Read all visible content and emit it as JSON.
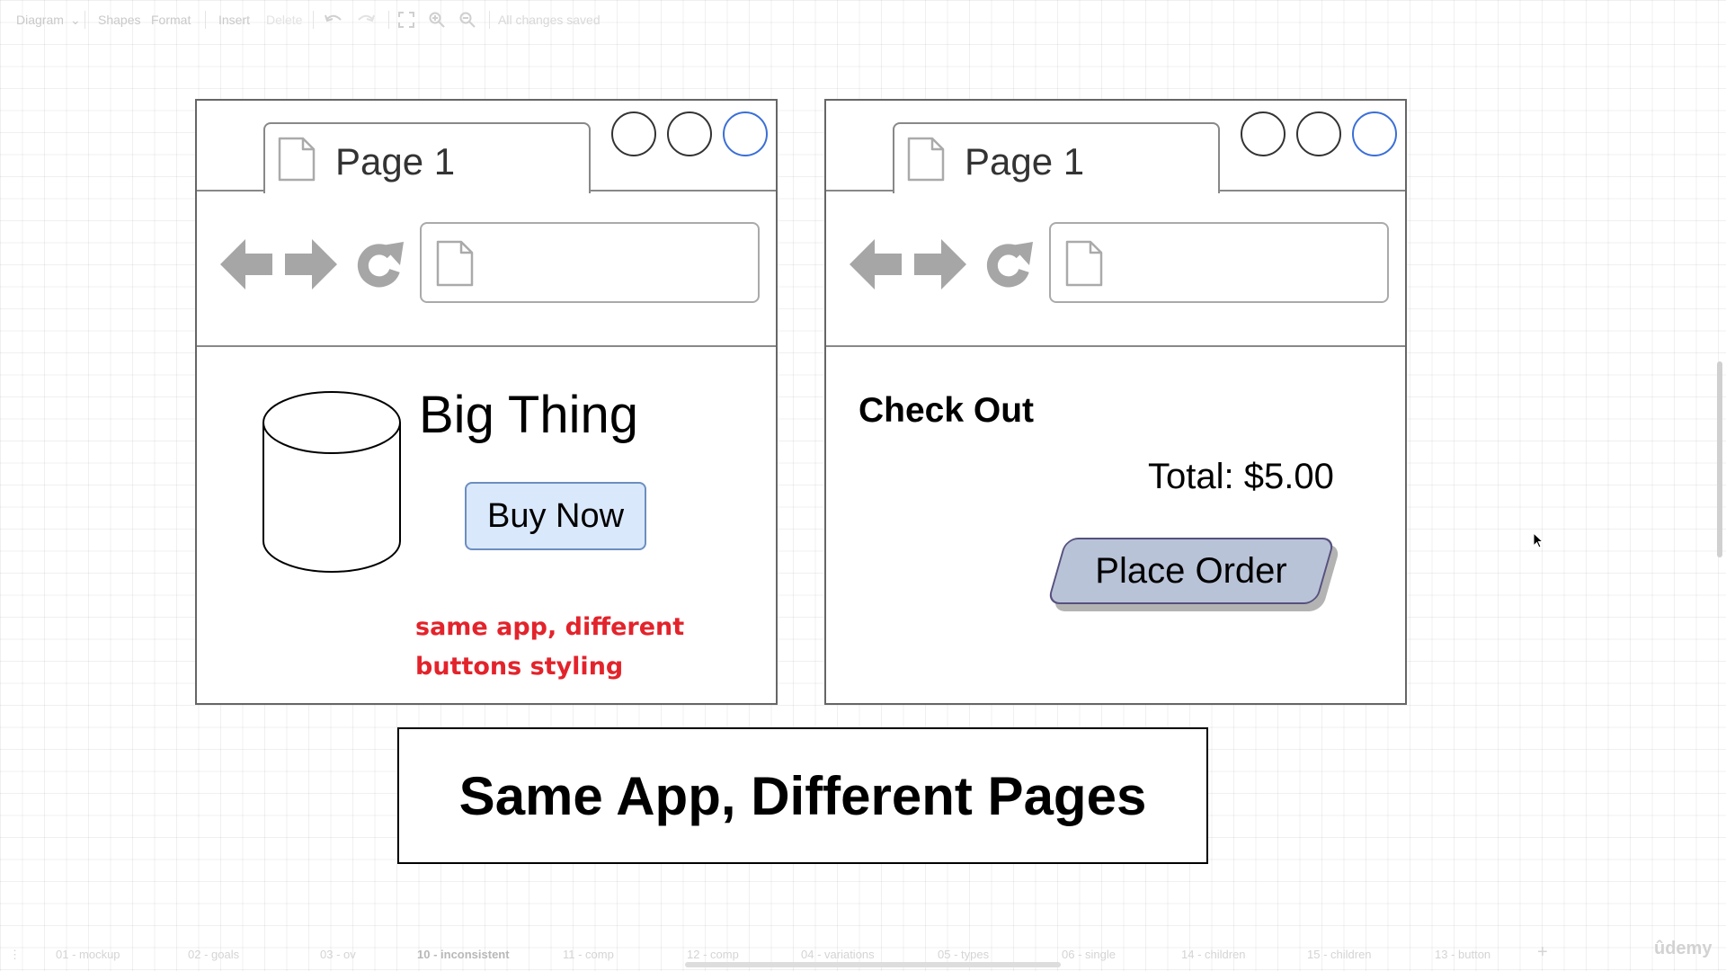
{
  "toolbar": {
    "diagram_menu": "Diagram",
    "shapes": "Shapes",
    "format": "Format",
    "insert": "Insert",
    "delete": "Delete",
    "status": "All changes saved"
  },
  "left_browser": {
    "tab_label": "Page 1",
    "title": "Big Thing",
    "buy_button": "Buy Now",
    "note_line1": "same app, different",
    "note_line2": "buttons styling"
  },
  "right_browser": {
    "tab_label": "Page 1",
    "title": "Check Out",
    "total": "Total: $5.00",
    "order_button": "Place Order"
  },
  "caption": "Same App, Different Pages",
  "page_tabs": [
    {
      "label": "01 - mockup",
      "active": false
    },
    {
      "label": "02 - goals",
      "active": false
    },
    {
      "label": "03 - ov",
      "active": false
    },
    {
      "label": "10 - inconsistent",
      "active": true
    },
    {
      "label": "11 - comp",
      "active": false
    },
    {
      "label": "12 - comp",
      "active": false
    },
    {
      "label": "04 - variations",
      "active": false
    },
    {
      "label": "05 - types",
      "active": false
    },
    {
      "label": "06 - single",
      "active": false
    },
    {
      "label": "14 - children",
      "active": false
    },
    {
      "label": "15 - children",
      "active": false
    },
    {
      "label": "13 - button",
      "active": false
    }
  ],
  "add_page_symbol": "+",
  "watermark": "ûdemy",
  "colors": {
    "buy_fill": "#dae8fc",
    "buy_stroke": "#6c8ebf",
    "order_fill": "#b9c3d8",
    "order_stroke": "#56517e",
    "note": "#e3232b",
    "active_circle": "#3a6fd8"
  },
  "icons": [
    "undo-icon",
    "redo-icon",
    "fullscreen-icon",
    "zoom-in-icon",
    "zoom-out-icon",
    "document-icon",
    "back-arrow-icon",
    "forward-arrow-icon",
    "reload-icon",
    "cylinder-icon",
    "mouse-cursor-icon"
  ]
}
